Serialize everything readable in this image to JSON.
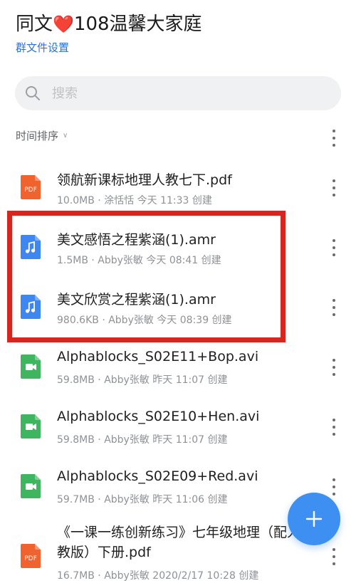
{
  "header": {
    "title_prefix": "同文",
    "title_heart": "❤️",
    "title_suffix": "108温馨大家庭",
    "settings_link": "群文件设置"
  },
  "search": {
    "placeholder": "搜索",
    "icon": "search-icon"
  },
  "sort": {
    "label": "时间排序",
    "icon": "chevron-down-icon"
  },
  "files": [
    {
      "name": "领航新课标地理人教七下.pdf",
      "meta": "10.0MB · 涂恬恬 今天 11:33 创建",
      "type": "pdf"
    },
    {
      "name": "美文感悟之程紫涵(1).amr",
      "meta": "1.5MB · Abby张敏 今天 08:41 创建",
      "type": "audio"
    },
    {
      "name": "美文欣赏之程紫涵(1).amr",
      "meta": "980.6KB · Abby张敏 今天 08:39 创建",
      "type": "audio"
    },
    {
      "name": "Alphablocks_S02E11+Bop.avi",
      "meta": "59.8MB · Abby张敏 昨天 11:07 创建",
      "type": "video"
    },
    {
      "name": "Alphablocks_S02E10+Hen.avi",
      "meta": "59.8MB · Abby张敏 昨天 11:07 创建",
      "type": "video"
    },
    {
      "name": "Alphablocks_S02E09+Red.avi",
      "meta": "59.7MB · Abby张敏 昨天 11:06 创建",
      "type": "video"
    },
    {
      "name": "《一课一练创新练习》七年级地理（配人教版）下册.pdf",
      "meta": "16.7MB · Abby张敏 2020/2/17 10:28 创建",
      "type": "pdf"
    }
  ],
  "pdf_icon_text": "PDF",
  "colors": {
    "pdf": "#f0622e",
    "audio": "#3e86f0",
    "video": "#3fb55f",
    "link": "#2f6fd6",
    "highlight_border": "#d5261f",
    "fab": "#3d8ff2"
  },
  "fab": {
    "icon": "plus-icon"
  }
}
